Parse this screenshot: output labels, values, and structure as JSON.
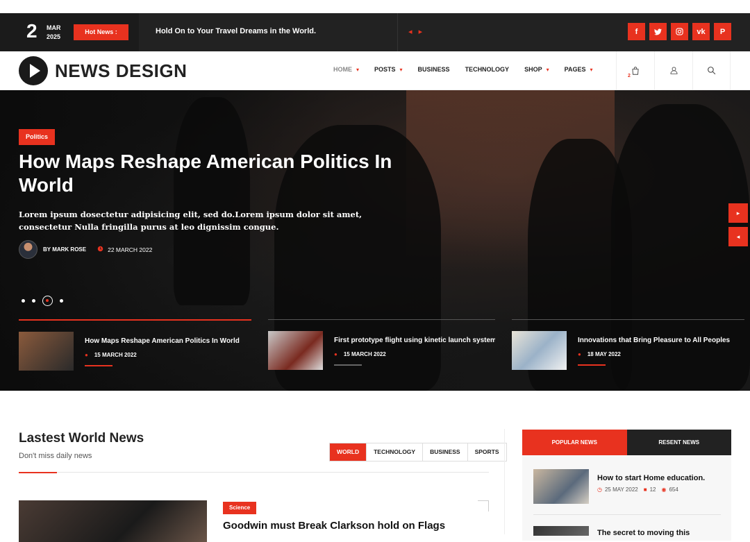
{
  "topbar": {
    "day": "2",
    "month": "MAR",
    "year": "2025",
    "hot_label": "Hot News :",
    "ticker": "Hold On to Your Travel Dreams in the World.",
    "prev_icon": "◂",
    "next_icon": "▸",
    "socials": [
      {
        "icon": "facebook-icon",
        "glyph": "f"
      },
      {
        "icon": "twitter-icon",
        "glyph": "🐦"
      },
      {
        "icon": "instagram-icon",
        "glyph": "◎"
      },
      {
        "icon": "vk-icon",
        "glyph": "vk"
      },
      {
        "icon": "pinterest-icon",
        "glyph": "P"
      }
    ]
  },
  "nav": {
    "logo": "NEWS DESIGN",
    "menu": [
      {
        "label": "HOME",
        "caret": "▾"
      },
      {
        "label": "POSTS",
        "caret": "▾"
      },
      {
        "label": "BUSINESS",
        "caret": ""
      },
      {
        "label": "TECHNOLOGY",
        "caret": ""
      },
      {
        "label": "SHOP",
        "caret": "▾"
      },
      {
        "label": "PAGES",
        "caret": "▾"
      }
    ],
    "cart_count": "2"
  },
  "hero": {
    "category": "Politics",
    "title": "How Maps Reshape American Politics In World",
    "description": "Lorem ipsum dosectetur adipisicing elit, sed do.Lorem ipsum dolor sit amet, consectetur Nulla fringilla purus at leo dignissim congue.",
    "author": "BY MARK ROSE",
    "date": "22 MARCH 2022",
    "next_icon": "▸",
    "prev_icon": "◂",
    "thumbs": [
      {
        "title": "How Maps Reshape American Politics In World",
        "date": "15 MARCH 2022"
      },
      {
        "title": "First prototype flight using kinetic launch system",
        "date": "15 MARCH 2022"
      },
      {
        "title": "Innovations that Bring Pleasure to All Peoples",
        "date": "18 MAY 2022"
      }
    ]
  },
  "latest": {
    "title": "Lastest World News",
    "subtitle": "Don't miss daily news",
    "filters": [
      "WORLD",
      "TECHNOLOGY",
      "BUSINESS",
      "SPORTS"
    ],
    "article": {
      "category": "Science",
      "title": "Goodwin must Break Clarkson hold on Flags"
    }
  },
  "widget": {
    "tabs": [
      "POPULAR NEWS",
      "RESENT NEWS"
    ],
    "items": [
      {
        "title": "How to start Home education.",
        "date": "25 MAY 2022",
        "comments": "12",
        "views": "654"
      },
      {
        "title": "The secret to moving this",
        "date": "",
        "comments": "",
        "views": ""
      }
    ]
  },
  "colors": {
    "accent": "#e8321f",
    "dark": "#222222"
  }
}
